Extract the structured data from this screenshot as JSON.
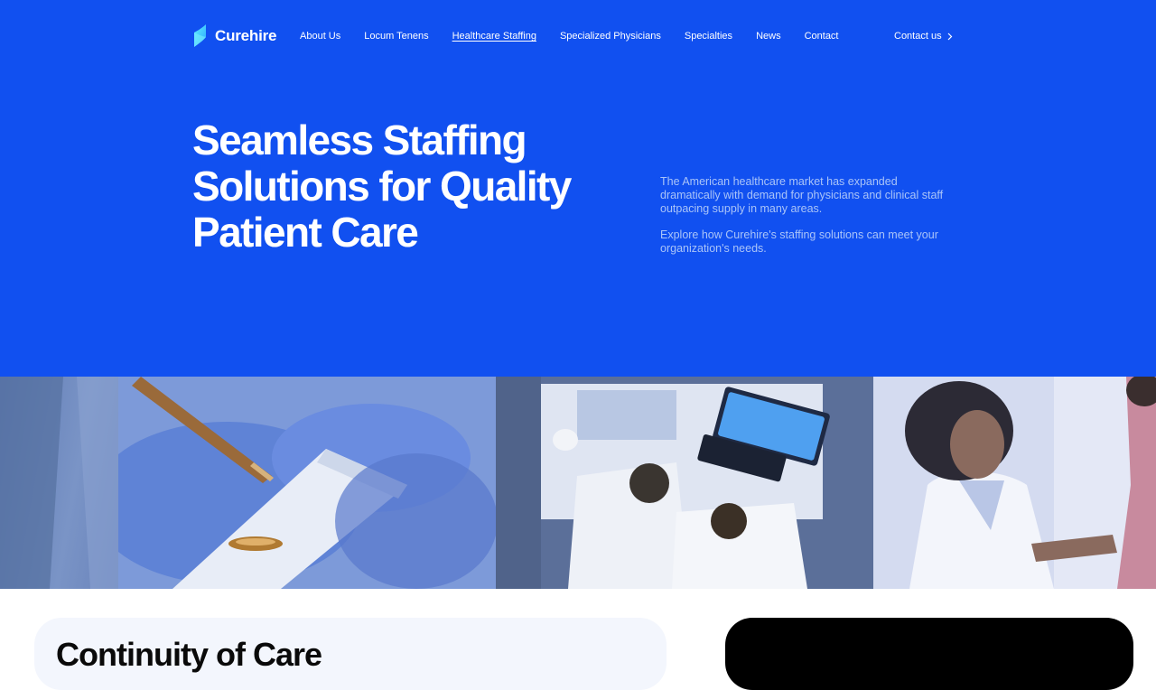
{
  "brand": {
    "name": "Curehire",
    "logo_icon": "leaf-logo-icon",
    "accent": "#1150f0"
  },
  "nav": {
    "items": [
      {
        "label": "About Us",
        "active": false
      },
      {
        "label": "Locum Tenens",
        "active": false
      },
      {
        "label": "Healthcare Staffing",
        "active": true
      },
      {
        "label": "Specialized Physicians",
        "active": false
      },
      {
        "label": "Specialties",
        "active": false
      },
      {
        "label": "News",
        "active": false
      },
      {
        "label": "Contact",
        "active": false
      }
    ],
    "cta_label": "Contact us",
    "cta_icon": "chevron-right-icon"
  },
  "hero": {
    "title": "Seamless Staffing Solutions for Quality Patient Care",
    "paragraph_1": "The American healthcare market has expanded dramatically with demand for physicians and clinical staff outpacing supply in many areas.",
    "paragraph_2": "Explore how Curehire's staffing solutions can meet your organization's needs."
  },
  "next_section": {
    "title": "Continuity of Care"
  }
}
